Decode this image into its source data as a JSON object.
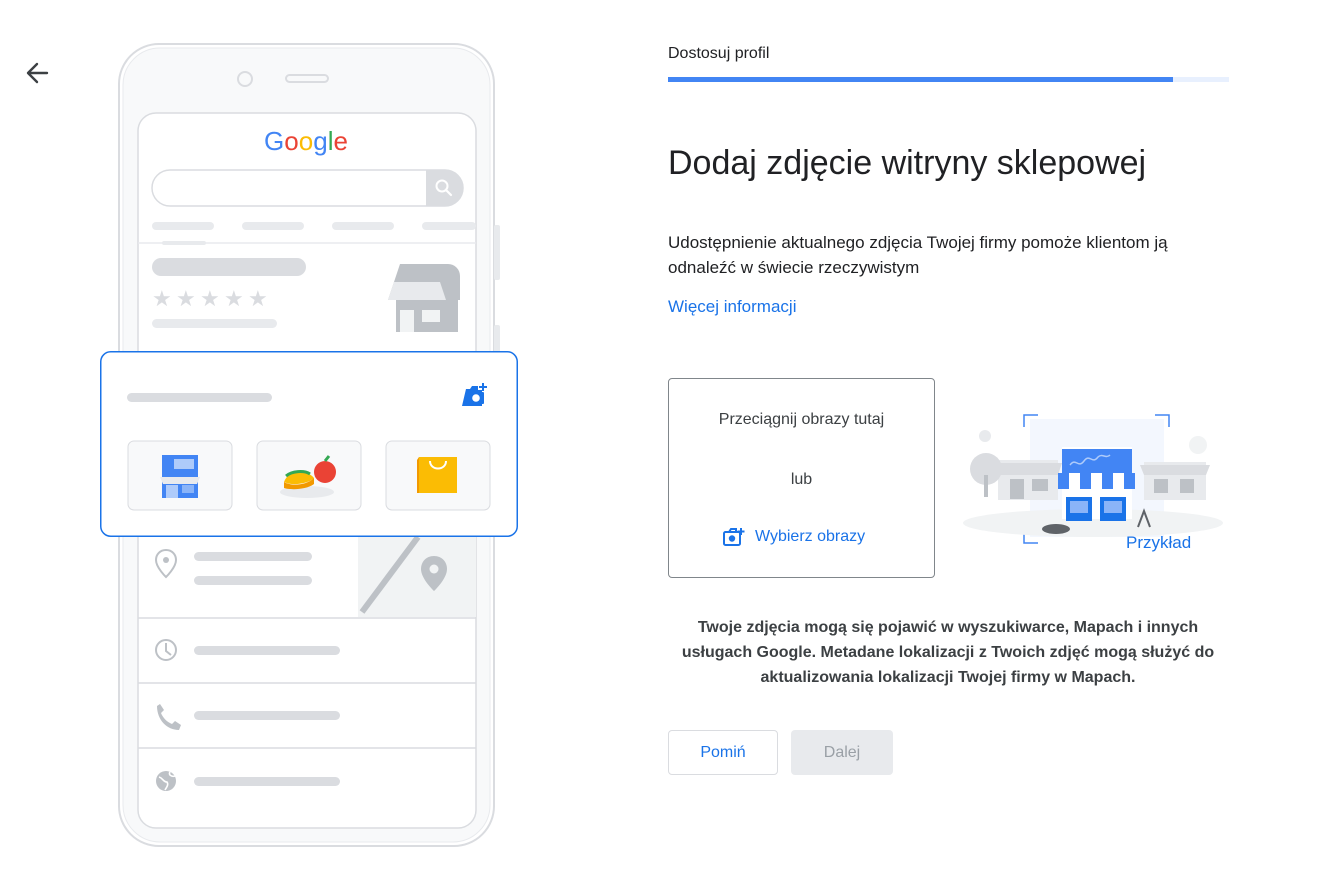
{
  "header": {
    "back_icon": "arrow-back-icon",
    "step_label": "Dostosuj profil",
    "progress_percent": 90
  },
  "main": {
    "title": "Dodaj zdjęcie witryny sklepowej",
    "description": "Udostępnienie aktualnego zdjęcia Twojej firmy pomoże klientom ją odnaleźć w świecie rzeczywistym",
    "more_info_link": "Więcej informacji"
  },
  "dropzone": {
    "drag_text": "Przeciągnij obrazy tutaj",
    "or_text": "lub",
    "choose_label": "Wybierz obrazy",
    "choose_icon": "add-photo-icon"
  },
  "example": {
    "label": "Przykład"
  },
  "notice": "Twoje zdjęcia mogą się pojawić w wyszukiwarce, Mapach i innych usługach Google. Metadane lokalizacji z Twoich zdjęć mogą służyć do aktualizowania lokalizacji Twojej firmy w Mapach.",
  "buttons": {
    "skip": "Pomiń",
    "next": "Dalej"
  },
  "illustration": {
    "logo_letters": [
      "G",
      "o",
      "o",
      "g",
      "l",
      "e"
    ],
    "logo_colors": [
      "#4285f4",
      "#ea4335",
      "#fbbc04",
      "#4285f4",
      "#34a853",
      "#ea4335"
    ],
    "rating_stars": 5
  }
}
